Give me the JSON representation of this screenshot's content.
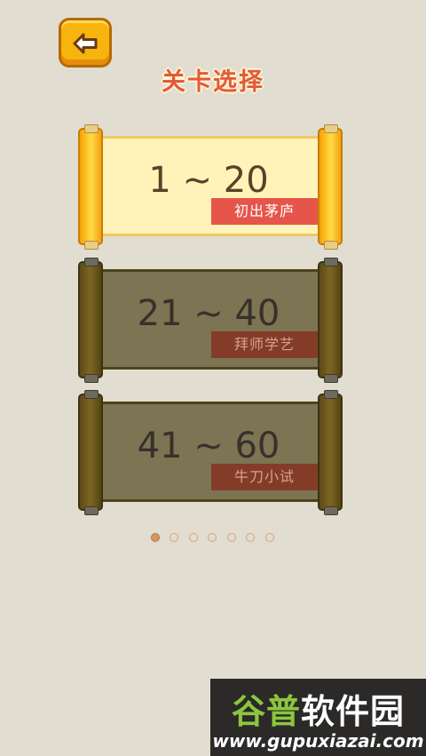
{
  "header": {
    "title": "关卡选择",
    "back_icon": "arrow-left-icon"
  },
  "levels": [
    {
      "range": "1 ~ 20",
      "name": "初出茅庐",
      "state": "unlocked"
    },
    {
      "range": "21 ~ 40",
      "name": "拜师学艺",
      "state": "locked"
    },
    {
      "range": "41 ~ 60",
      "name": "牛刀小试",
      "state": "locked"
    }
  ],
  "pagination": {
    "total": 7,
    "current": 1
  },
  "watermark": {
    "brand_first": "谷普",
    "brand_rest": "软件园",
    "url": "www.gupuxiazai.com"
  },
  "colors": {
    "background": "#e1ddd0",
    "title": "#e25a3a",
    "active_tag": "#e5554a",
    "locked_tag": "#843c28",
    "button": "#f6b40e"
  }
}
